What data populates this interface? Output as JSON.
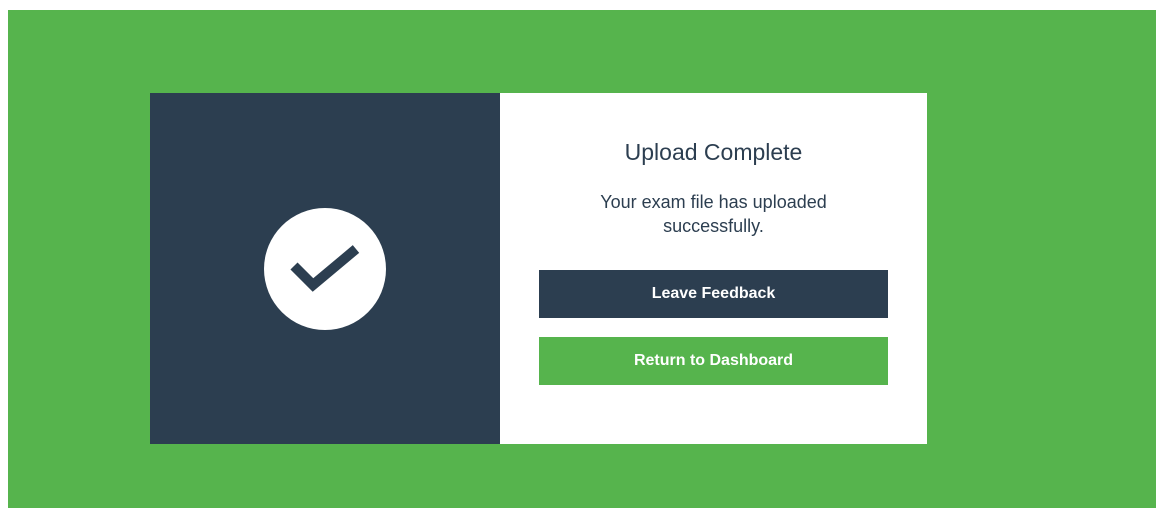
{
  "colors": {
    "background_green": "#56b44d",
    "dark_navy": "#2c3e50",
    "white": "#ffffff"
  },
  "dialog": {
    "icon": "checkmark-circle-icon",
    "title": "Upload Complete",
    "message": "Your exam file has uploaded successfully.",
    "buttons": {
      "feedback_label": "Leave Feedback",
      "dashboard_label": "Return to Dashboard"
    }
  }
}
